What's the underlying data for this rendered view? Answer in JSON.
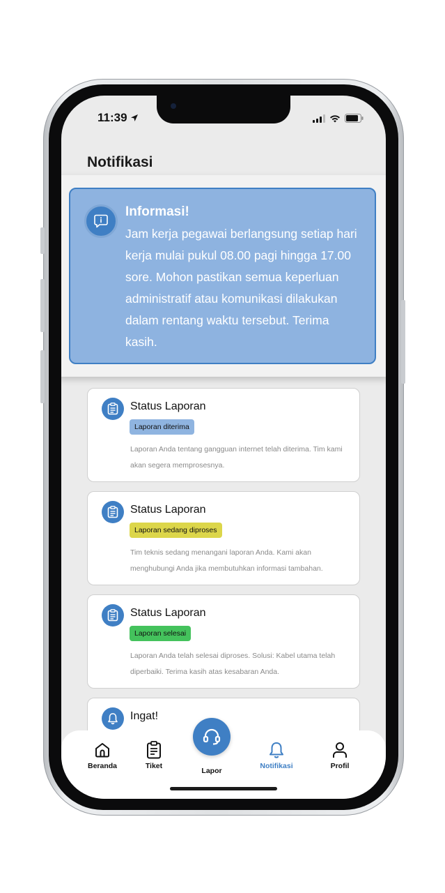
{
  "status_bar": {
    "time": "11:39"
  },
  "page": {
    "title": "Notifikasi"
  },
  "info": {
    "title": "Informasi!",
    "text": "Jam kerja pegawai berlangsung setiap hari kerja mulai pukul 08.00 pagi hingga 17.00 sore. Mohon pastikan semua keperluan administratif atau komunikasi dilakukan dalam rentang waktu tersebut. Terima kasih."
  },
  "notifications": [
    {
      "title": "Status Laporan",
      "badge": "Laporan diterima",
      "badge_color": "#8fb4e0",
      "desc": "Laporan Anda tentang gangguan internet telah diterima. Tim kami akan segera memprosesnya.",
      "icon": "clipboard-icon"
    },
    {
      "title": "Status Laporan",
      "badge": "Laporan sedang diproses",
      "badge_color": "#dcd64a",
      "desc": "Tim teknis sedang menangani laporan Anda. Kami akan menghubungi Anda jika membutuhkan informasi tambahan.",
      "icon": "clipboard-icon"
    },
    {
      "title": "Status Laporan",
      "badge": "Laporan selesai",
      "badge_color": "#44c25c",
      "desc": "Laporan Anda telah selesai diproses. Solusi: Kabel utama telah diperbaiki. Terima kasih atas kesabaran Anda.",
      "icon": "clipboard-icon"
    },
    {
      "title": "Ingat!",
      "icon": "bell-icon"
    }
  ],
  "nav": {
    "beranda": "Beranda",
    "tiket": "Tiket",
    "lapor": "Lapor",
    "notifikasi": "Notifikasi",
    "profil": "Profil"
  },
  "colors": {
    "accent": "#3f7fc4",
    "info_bg": "#8eb3e0"
  }
}
